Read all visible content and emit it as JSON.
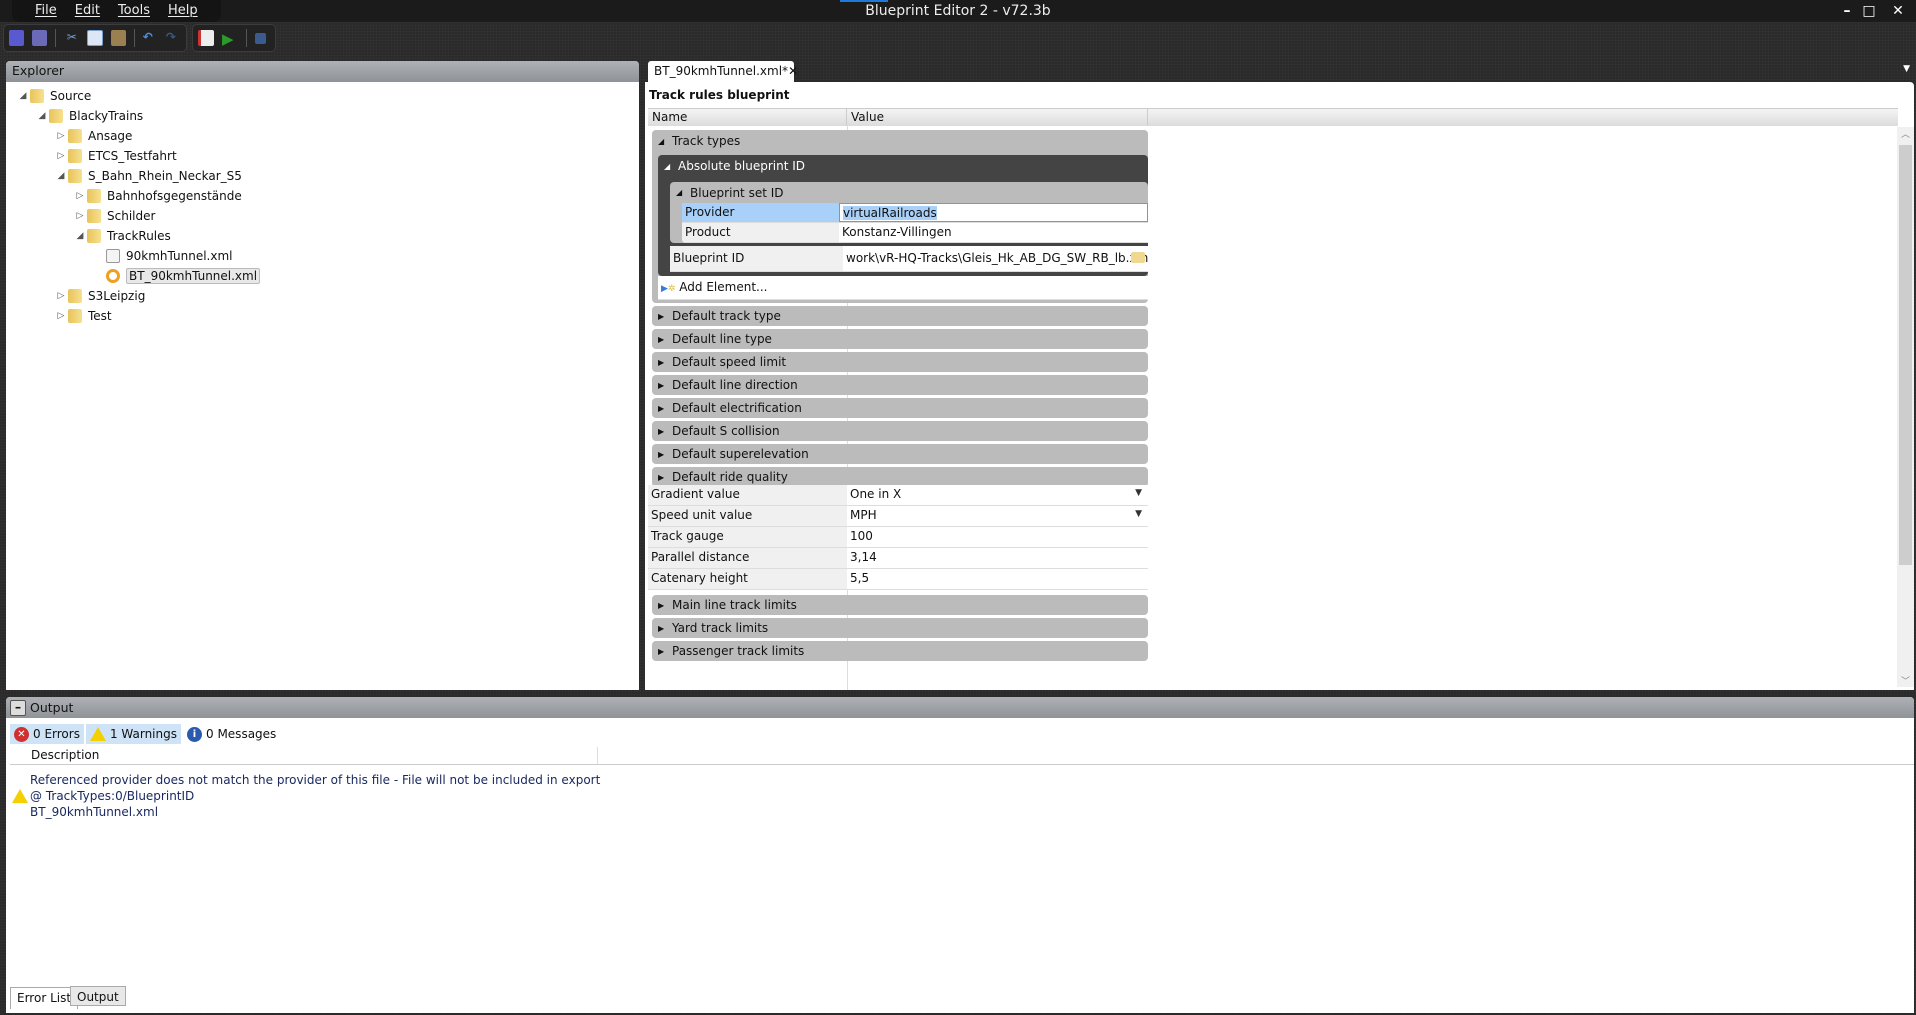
{
  "app": {
    "title": "Blueprint Editor 2 - v72.3b",
    "menu": [
      "File",
      "Edit",
      "Tools",
      "Help"
    ],
    "window_controls": [
      "minimize",
      "maximize",
      "close"
    ]
  },
  "toolbar": {
    "icons": [
      "save-icon",
      "save-all-icon",
      "cut-icon",
      "copy-icon",
      "paste-icon",
      "undo-icon",
      "redo-icon",
      "export-icon",
      "run-icon",
      "stop-icon"
    ]
  },
  "explorer": {
    "title": "Explorer",
    "tree": [
      {
        "label": "Source",
        "level": 0,
        "expanded": true,
        "type": "folder"
      },
      {
        "label": "BlackyTrains",
        "level": 1,
        "expanded": true,
        "type": "folder"
      },
      {
        "label": "Ansage",
        "level": 2,
        "expanded": false,
        "type": "folder"
      },
      {
        "label": "ETCS_Testfahrt",
        "level": 2,
        "expanded": false,
        "type": "folder"
      },
      {
        "label": "S_Bahn_Rhein_Neckar_S5",
        "level": 2,
        "expanded": true,
        "type": "folder"
      },
      {
        "label": "Bahnhofsgegenstände",
        "level": 3,
        "expanded": false,
        "type": "folder"
      },
      {
        "label": "Schilder",
        "level": 3,
        "expanded": false,
        "type": "folder"
      },
      {
        "label": "TrackRules",
        "level": 3,
        "expanded": true,
        "type": "folder"
      },
      {
        "label": "90kmhTunnel.xml",
        "level": 4,
        "type": "xml"
      },
      {
        "label": "BT_90kmhTunnel.xml",
        "level": 4,
        "type": "blueprint",
        "selected": true
      },
      {
        "label": "S3Leipzig",
        "level": 2,
        "expanded": false,
        "type": "folder"
      },
      {
        "label": "Test",
        "level": 2,
        "expanded": false,
        "type": "folder"
      }
    ]
  },
  "editor": {
    "tab": "BT_90kmhTunnel.xml*",
    "title": "Track rules blueprint",
    "columns": [
      "Name",
      "Value"
    ],
    "track_types": "Track types",
    "absolute_id": "Absolute blueprint ID",
    "set_id": "Blueprint set ID",
    "provider": {
      "name": "Provider",
      "value": "virtualRailroads"
    },
    "product": {
      "name": "Product",
      "value": "Konstanz-Villingen"
    },
    "blueprint_id": {
      "name": "Blueprint ID",
      "value": "work\\vR-HQ-Tracks\\Gleis_Hk_AB_DG_SW_RB_lb.xml"
    },
    "add_element": "Add Element...",
    "groups": [
      "Default track type",
      "Default line type",
      "Default speed limit",
      "Default line direction",
      "Default electrification",
      "Default S collision",
      "Default superelevation",
      "Default ride quality"
    ],
    "properties": [
      {
        "name": "Gradient value",
        "value": "One in X",
        "dropdown": true
      },
      {
        "name": "Speed unit value",
        "value": "MPH",
        "dropdown": true
      },
      {
        "name": "Track gauge",
        "value": "100"
      },
      {
        "name": "Parallel distance",
        "value": "3,14"
      },
      {
        "name": "Catenary height",
        "value": "5,5"
      }
    ],
    "groups2": [
      "Main line track limits",
      "Yard track limits",
      "Passenger track limits"
    ]
  },
  "output": {
    "title": "Output",
    "filters": {
      "errors": "0 Errors",
      "warnings": "1 Warnings",
      "messages": "0 Messages"
    },
    "column": "Description",
    "messages": [
      {
        "severity": "warning",
        "lines": [
          "Referenced provider does not match the provider of this file - File will not be included in export",
          "@ TrackTypes:0/BlueprintID",
          "BT_90kmhTunnel.xml"
        ]
      }
    ],
    "tabs": [
      "Error List",
      "Output"
    ]
  },
  "colors": {
    "accent": "#1e7ad6",
    "selection": "#a8d0f8",
    "group": "#bbbbbb",
    "group_dark": "#444444"
  }
}
